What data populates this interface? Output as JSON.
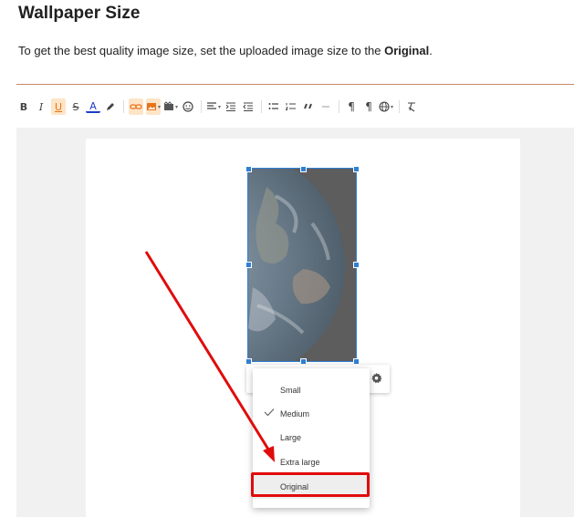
{
  "heading": "Wallpaper Size",
  "description": {
    "prefix": "To get the best quality image size, set the uploaded image size to the ",
    "bold": "Original",
    "suffix": "."
  },
  "toolbar": {
    "bold": "B",
    "italic": "I",
    "underline": "U",
    "strike": "S",
    "font_color": "A"
  },
  "image_size_menu": {
    "items": [
      {
        "label": "Small",
        "checked": false
      },
      {
        "label": "Medium",
        "checked": true
      },
      {
        "label": "Large",
        "checked": false
      },
      {
        "label": "Extra large",
        "checked": false
      },
      {
        "label": "Original",
        "checked": false
      }
    ],
    "highlighted": "Original"
  },
  "colors": {
    "accent": "#e8741a",
    "selection": "#2f7fd6",
    "annotation": "#e10b0b"
  }
}
